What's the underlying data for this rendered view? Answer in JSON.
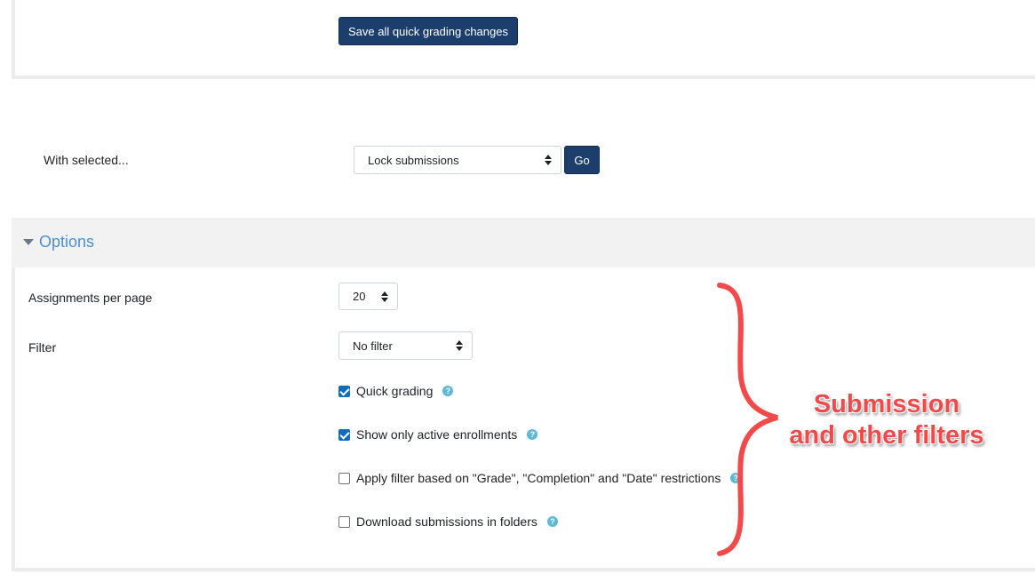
{
  "top": {
    "save_label": "Save all quick grading changes"
  },
  "bulk": {
    "with_selected_label": "With selected...",
    "action_selected": "Lock submissions",
    "go_label": "Go"
  },
  "options": {
    "title": "Options",
    "per_page_label": "Assignments per page",
    "per_page_value": "20",
    "filter_label": "Filter",
    "filter_value": "No filter",
    "checkboxes": [
      {
        "label": "Quick grading",
        "checked": true
      },
      {
        "label": "Show only active enrollments",
        "checked": true
      },
      {
        "label": "Apply filter based on \"Grade\", \"Completion\" and \"Date\" restrictions",
        "checked": false
      },
      {
        "label": "Download submissions in folders",
        "checked": false
      }
    ]
  },
  "annotation": {
    "line1": "Submission",
    "line2": "and other filters"
  },
  "colors": {
    "primary_button": "#1b3e6d",
    "link_blue": "#4b8fd0",
    "checkbox_blue": "#0f6cbf",
    "help_icon": "#5fb8d8",
    "annotation_red": "#f24a4a"
  },
  "icons": [
    "caret-down-icon",
    "select-arrows-icon",
    "help-icon",
    "curly-brace-icon"
  ]
}
